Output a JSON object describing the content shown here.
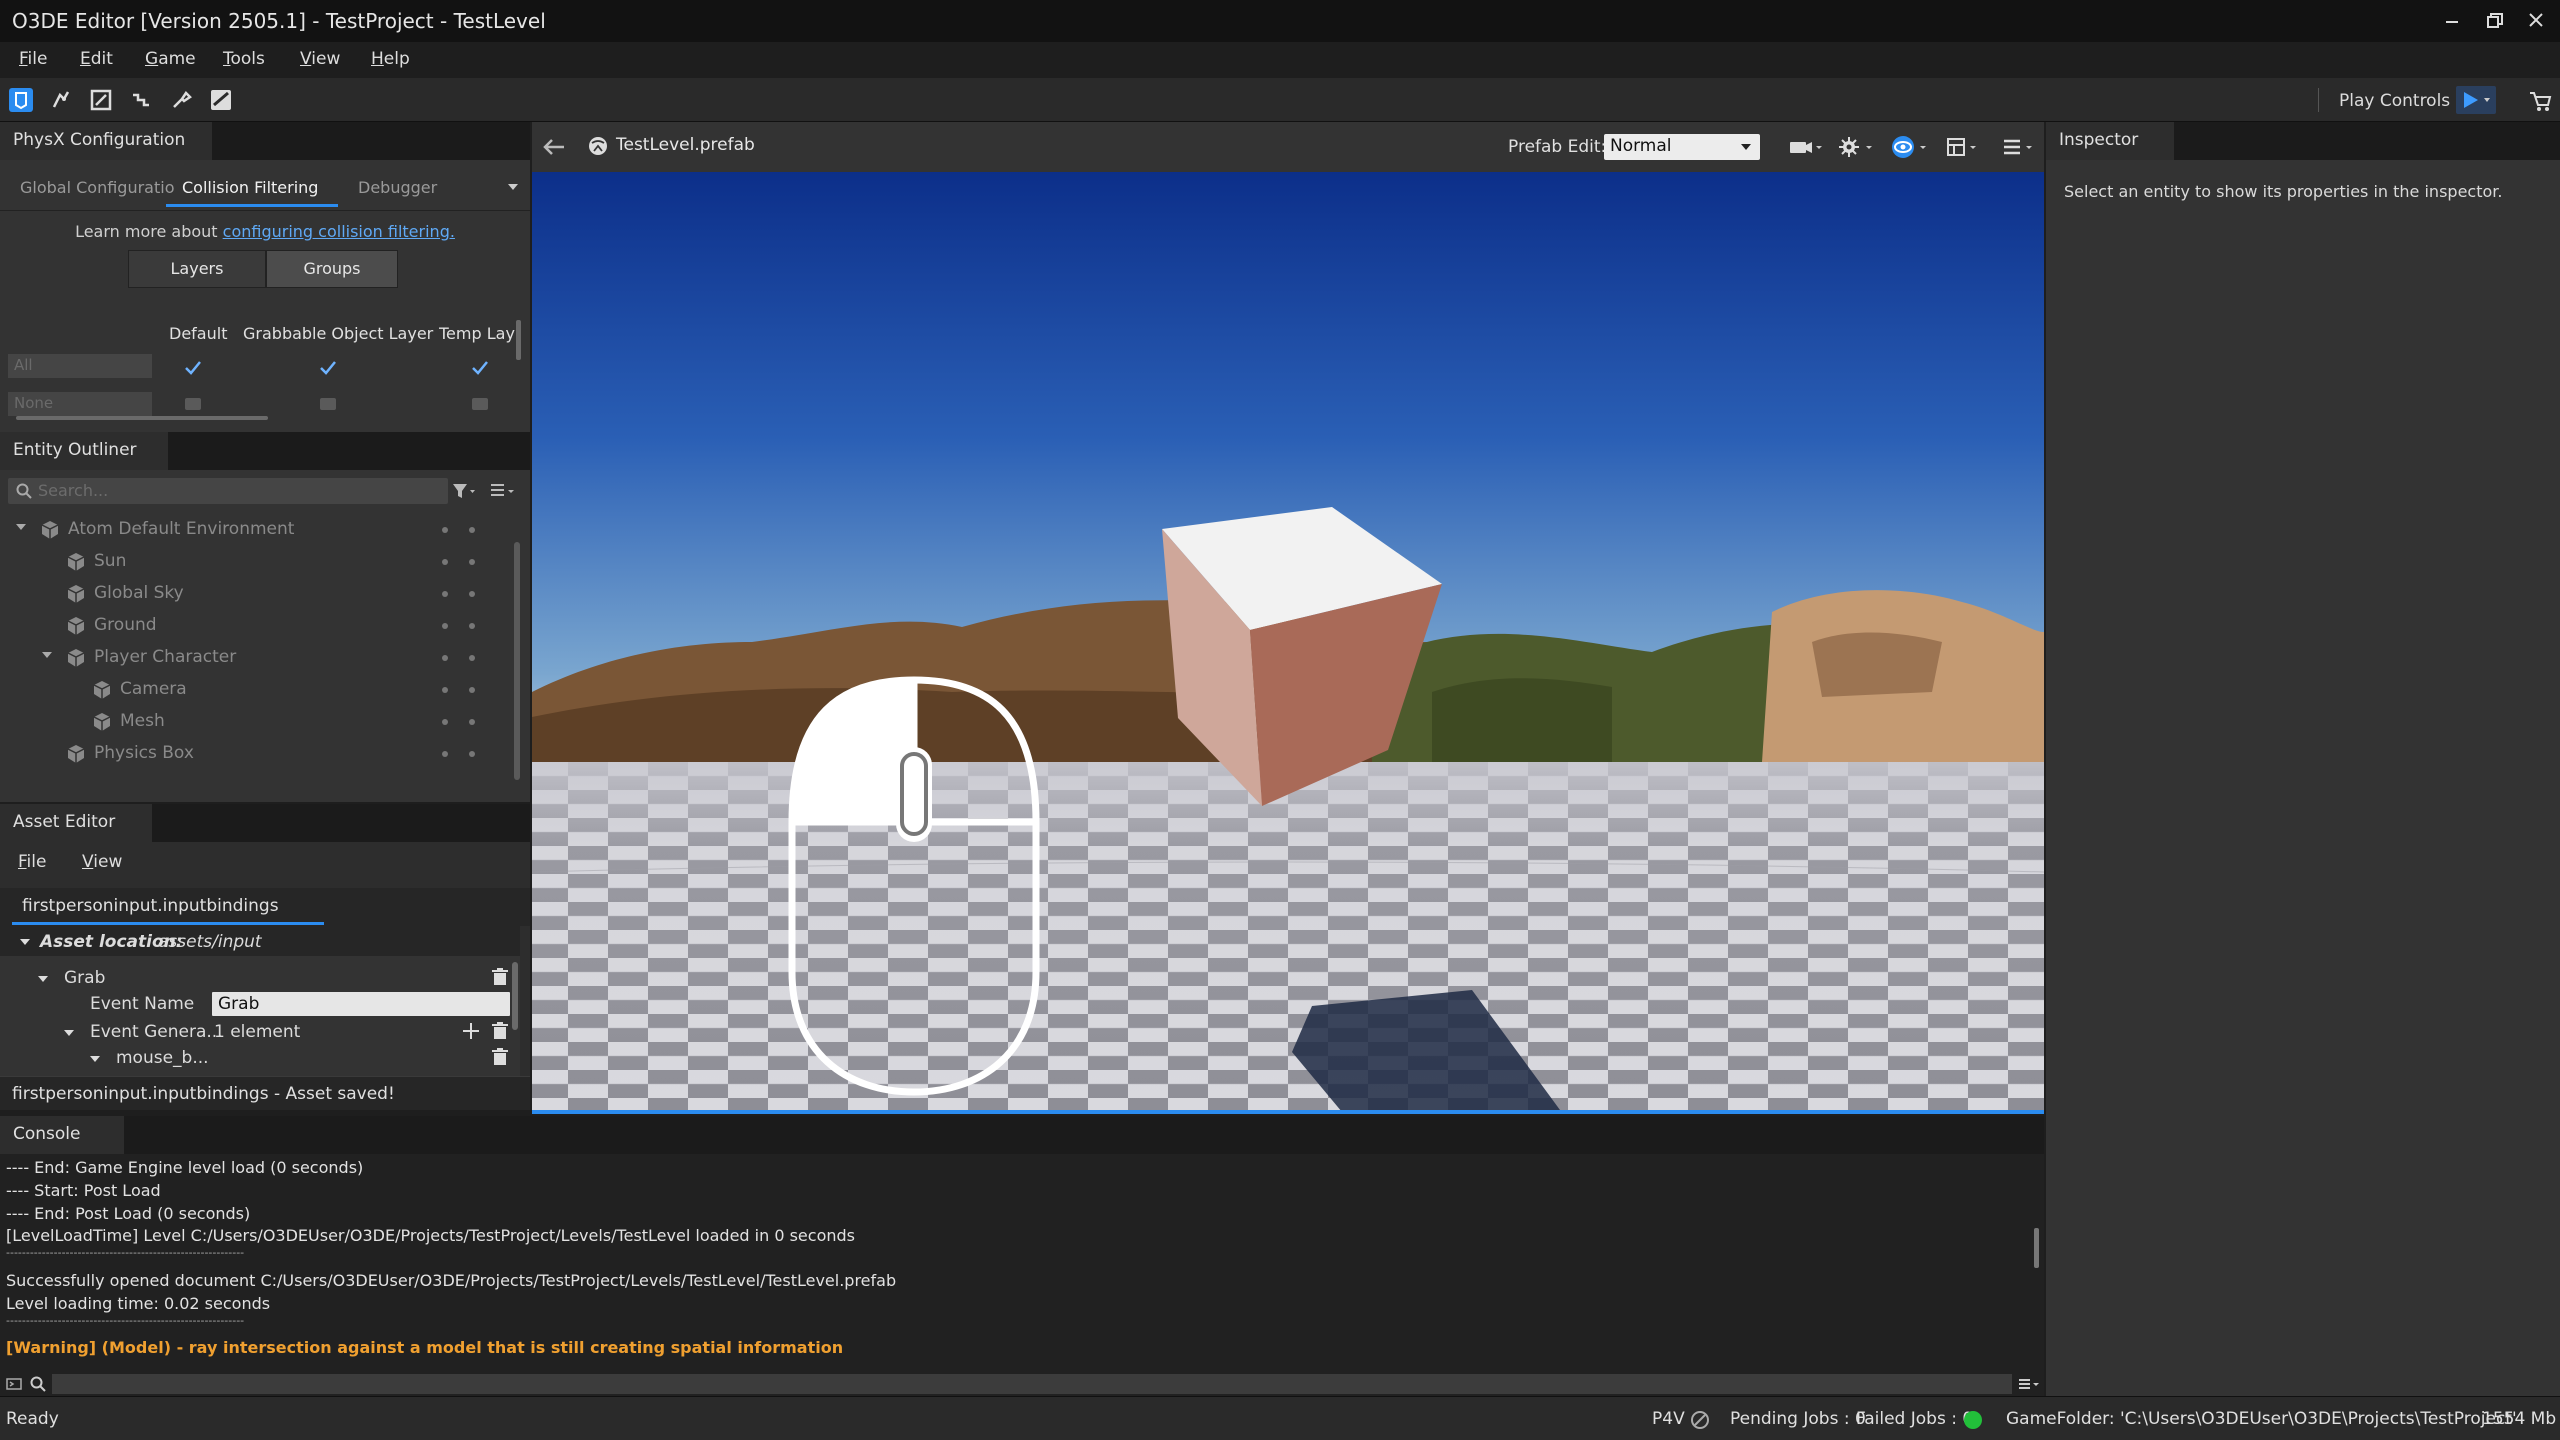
{
  "window": {
    "title": "O3DE Editor [Version 2505.1] - TestProject - TestLevel"
  },
  "menubar": {
    "items": [
      "File",
      "Edit",
      "Game",
      "Tools",
      "View",
      "Help"
    ]
  },
  "toolbar": {
    "play_controls_label": "Play Controls",
    "accent": "#2b8cf0"
  },
  "physx": {
    "panel_title": "PhysX Configuration",
    "tabs": [
      "Global Configuratio",
      "Collision Filtering",
      "Debugger"
    ],
    "active_tab": "Collision Filtering",
    "learn_prefix": "Learn more about",
    "learn_link": "configuring collision filtering.",
    "segments": [
      "Layers",
      "Groups"
    ],
    "active_segment": "Layers",
    "columns": [
      "Default",
      "Grabbable Object Layer",
      "Temp Lay"
    ],
    "rows": [
      {
        "label": "All",
        "checks": [
          true,
          true,
          true
        ]
      },
      {
        "label": "None",
        "checks": [
          false,
          false,
          false
        ]
      }
    ]
  },
  "outliner": {
    "panel_title": "Entity Outliner",
    "search_placeholder": "Search...",
    "entities": [
      {
        "label": "Atom Default Environment",
        "depth": 0,
        "expanded": true
      },
      {
        "label": "Sun",
        "depth": 1
      },
      {
        "label": "Global Sky",
        "depth": 1
      },
      {
        "label": "Ground",
        "depth": 1
      },
      {
        "label": "Player Character",
        "depth": 1,
        "expanded": true
      },
      {
        "label": "Camera",
        "depth": 2
      },
      {
        "label": "Mesh",
        "depth": 2
      },
      {
        "label": "Physics Box",
        "depth": 1
      }
    ]
  },
  "asset_editor": {
    "panel_title": "Asset Editor",
    "menu": [
      "File",
      "View"
    ],
    "file_tab": "firstpersoninput.inputbindings",
    "location_label": "Asset location:",
    "location_value": "assets/input",
    "group_name": "Grab",
    "event_name_label": "Event Name",
    "event_name_value": "Grab",
    "event_generators_label": "Event Genera...",
    "event_generators_value": "1 element",
    "child_item": "mouse_b...",
    "status": "firstpersoninput.inputbindings - Asset saved!"
  },
  "viewport": {
    "back_label": "←",
    "prefab_file": "TestLevel.prefab",
    "prefab_edit_label": "Prefab Edit:",
    "prefab_edit_value": "Normal"
  },
  "inspector": {
    "panel_title": "Inspector",
    "empty_message": "Select an entity to show its properties in the inspector."
  },
  "console": {
    "panel_title": "Console",
    "lines": [
      {
        "text": "---- End: Game Engine level load (0 seconds)",
        "warn": false
      },
      {
        "text": "---- Start: Post Load",
        "warn": false
      },
      {
        "text": "---- End: Post Load (0 seconds)",
        "warn": false
      },
      {
        "text": "[LevelLoadTime] Level C:/Users/O3DEUser/O3DE/Projects/TestProject/Levels/TestLevel loaded in 0 seconds",
        "warn": false
      },
      {
        "text": "------------------------------------------------------------",
        "warn": false
      },
      {
        "text": "Successfully opened document C:/Users/O3DEUser/O3DE/Projects/TestProject/Levels/TestLevel/TestLevel.prefab",
        "warn": false
      },
      {
        "text": "Level loading time: 0.02 seconds",
        "warn": false
      },
      {
        "text": "------------------------------------------------------------",
        "warn": false
      },
      {
        "text": "[Warning] (Model) - ray intersection against a model that is still creating spatial information",
        "warn": true
      }
    ],
    "warning_color": "#f0a030"
  },
  "statusbar": {
    "ready": "Ready",
    "p4v": "P4V",
    "pending_jobs": "Pending Jobs : 0",
    "failed_jobs": "Failed Jobs : 0",
    "game_folder": "GameFolder: 'C:\\Users\\O3DEUser\\O3DE\\Projects\\TestProject'",
    "memory": "1554 Mb",
    "ok_color": "#22c03a"
  }
}
